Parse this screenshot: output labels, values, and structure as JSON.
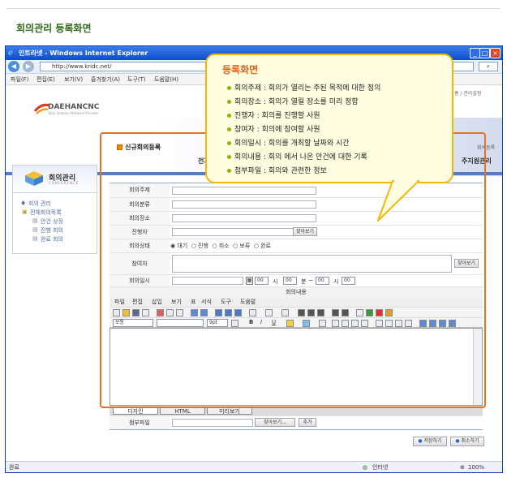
{
  "page": {
    "title": "회의관리 등록화면"
  },
  "browser": {
    "window_title": "인트라넷 - Windows Internet Explorer",
    "address": "http://www.kridc.net/",
    "menu": [
      "파일(F)",
      "편집(E)",
      "보기(V)",
      "즐겨찾기(A)",
      "도구(T)",
      "도움말(H)"
    ],
    "status_left": "완료",
    "status_zone": "인터넷",
    "zoom": "100%"
  },
  "site": {
    "logo": "DAEHANCNC",
    "logo_sub": "Total Solution Network Provider",
    "util_links": "홈 / 관리설정",
    "gnb": [
      "전자",
      "주지원관리"
    ]
  },
  "lnb": {
    "title": "회의관리",
    "subtitle": "CONFERENCE",
    "tree": [
      "회의 관리",
      "전체회의목록",
      "안건 상정",
      "진행 회의",
      "완료 회의"
    ]
  },
  "content": {
    "title": "신규회의등록",
    "location": "회의등록"
  },
  "form": {
    "labels": {
      "subject": "회의주제",
      "category": "회의분류",
      "place": "회의장소",
      "host": "진행자",
      "status": "회의상태",
      "attendees": "참여자",
      "datetime": "회의일시",
      "body": "회의내용",
      "attach": "첨부파일"
    },
    "find_button": "찾아보기",
    "status_options": [
      "대기",
      "진행",
      "취소",
      "보류",
      "완료"
    ],
    "time_default": "00",
    "unit_hour": "시",
    "unit_min": "분",
    "range_sep": "~",
    "attach_button": "찾아보기...",
    "attach_add": "추가",
    "save_button": "저장하기",
    "cancel_button": "취소하기"
  },
  "editor": {
    "menu": [
      "파일",
      "편집",
      "삽입",
      "보기",
      "표",
      "서식",
      "도구",
      "도움말"
    ],
    "style": "보통",
    "size": "9pt",
    "tabs": [
      "디자인",
      "HTML",
      "미리보기"
    ]
  },
  "callout": {
    "title": "등록화면",
    "items": [
      "회의주제 : 회의가 열리는 주된 목적에 대한 정의",
      "회의장소 : 회의가 열릴 장소를 미리 정함",
      "진행자 : 회의를 진행할 사원",
      "참여자 : 회의에 참여할 사원",
      "회의일시 : 회의를 개최할 날짜와 시간",
      "회의내용 : 회의 에서 나온 안건에 대한 기록",
      "첨부파일 : 회의와 관련한 정보"
    ]
  },
  "colors": {
    "accent": "#e8731c",
    "callout_border": "#f0b70a",
    "title_green": "#2f6b16"
  }
}
